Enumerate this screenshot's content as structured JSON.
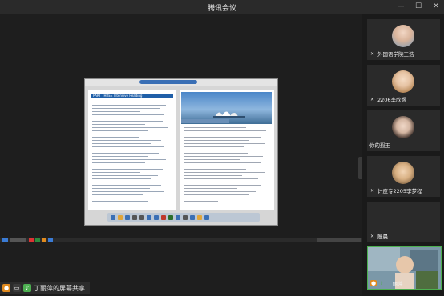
{
  "window": {
    "title": "腾讯会议",
    "controls": {
      "minimize": "—",
      "maximize": "☐",
      "close": "✕"
    }
  },
  "shared_screen": {
    "sharer_label": "丁丽萍的屏幕共享",
    "document": {
      "part_header": "PART THREE  Intensive Reading"
    }
  },
  "participants": [
    {
      "name": "外国语学院王浩",
      "icon": "user-icon"
    },
    {
      "name": "2206李欣煜",
      "icon": "user-icon"
    },
    {
      "name": "你的遐王",
      "icon": "user-icon"
    },
    {
      "name": "计应专2205李梦程",
      "icon": "user-icon"
    },
    {
      "name": "殷晨",
      "icon": "user-icon"
    },
    {
      "name": "丁丽萍",
      "icon": "user-icon"
    }
  ],
  "colors": {
    "accent": "#e08a1e",
    "mic_on": "#4caf50",
    "doc_blue": "#1f5fa8"
  }
}
